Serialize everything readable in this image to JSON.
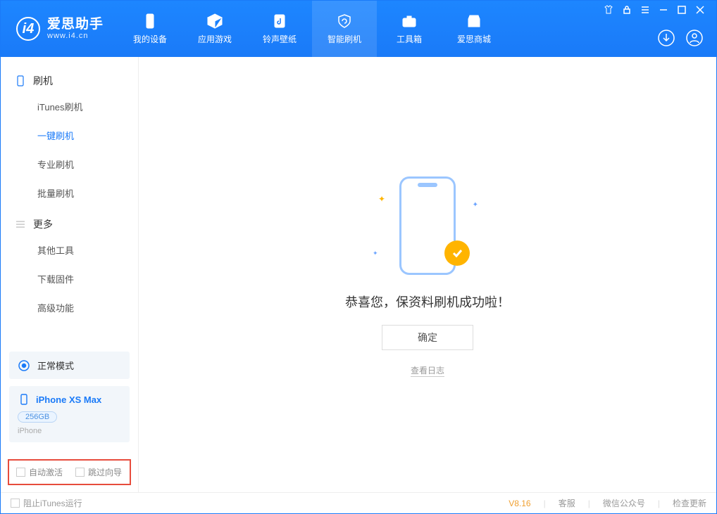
{
  "app": {
    "title": "爱思助手",
    "subtitle": "www.i4.cn"
  },
  "nav": {
    "items": [
      {
        "label": "我的设备"
      },
      {
        "label": "应用游戏"
      },
      {
        "label": "铃声壁纸"
      },
      {
        "label": "智能刷机"
      },
      {
        "label": "工具箱"
      },
      {
        "label": "爱思商城"
      }
    ]
  },
  "sidebar": {
    "group1_label": "刷机",
    "group1_items": [
      {
        "label": "iTunes刷机"
      },
      {
        "label": "一键刷机"
      },
      {
        "label": "专业刷机"
      },
      {
        "label": "批量刷机"
      }
    ],
    "group2_label": "更多",
    "group2_items": [
      {
        "label": "其他工具"
      },
      {
        "label": "下载固件"
      },
      {
        "label": "高级功能"
      }
    ],
    "mode_label": "正常模式",
    "device_name": "iPhone XS Max",
    "device_storage": "256GB",
    "device_type": "iPhone",
    "checkbox_auto_activate": "自动激活",
    "checkbox_skip_guide": "跳过向导"
  },
  "main": {
    "success_text": "恭喜您，保资料刷机成功啦！",
    "confirm_label": "确定",
    "view_log_label": "查看日志"
  },
  "footer": {
    "block_itunes": "阻止iTunes运行",
    "version": "V8.16",
    "links": [
      "客服",
      "微信公众号",
      "检查更新"
    ]
  }
}
